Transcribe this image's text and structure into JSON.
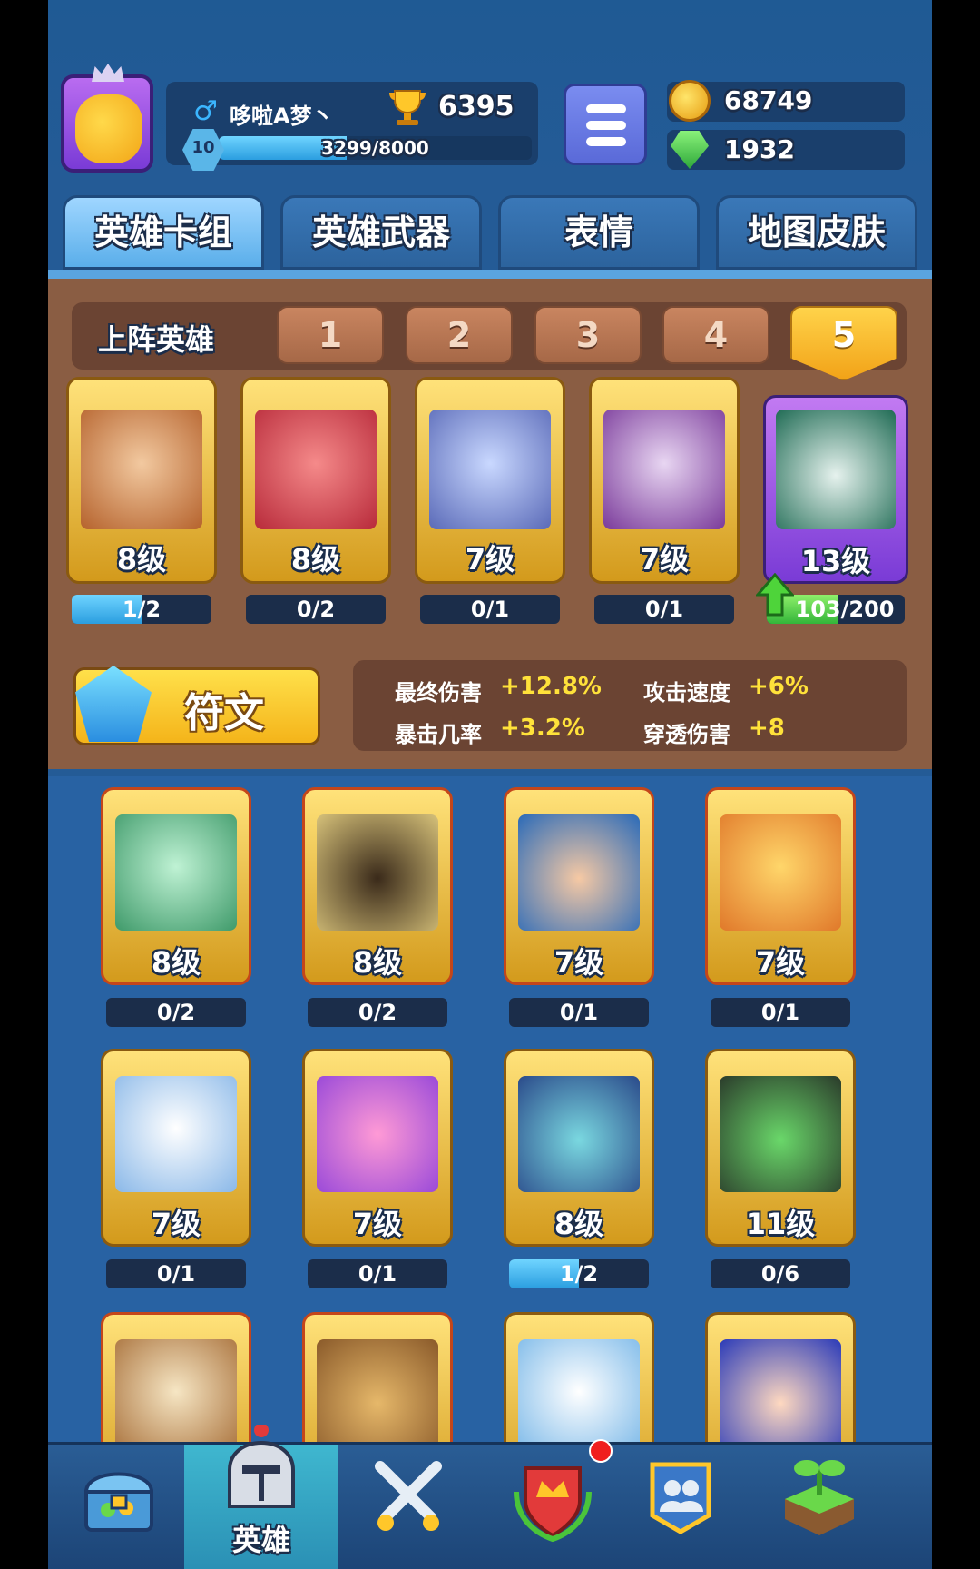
{
  "player": {
    "gender_symbol": "♂",
    "name": "哆啦A梦丶",
    "trophies": "6395",
    "level": "10",
    "xp_text": "3299/8000",
    "xp_progress": 0.41
  },
  "resources": {
    "coins": "68749",
    "gems": "1932"
  },
  "tabs": [
    "英雄卡组",
    "英雄武器",
    "表情",
    "地图皮肤"
  ],
  "deck": {
    "label": "上阵英雄",
    "slots": [
      "1",
      "2",
      "3",
      "4",
      "5"
    ],
    "selected_slot": "5",
    "heroes": [
      {
        "level": "8级",
        "progress": "1/2",
        "fill": 0.5
      },
      {
        "level": "8级",
        "progress": "0/2",
        "fill": 0
      },
      {
        "level": "7级",
        "progress": "0/1",
        "fill": 0
      },
      {
        "level": "7级",
        "progress": "0/1",
        "fill": 0
      },
      {
        "level": "13级",
        "progress": "103/200",
        "fill": 0.52
      }
    ]
  },
  "rune": {
    "label": "符文",
    "stats": [
      {
        "name": "最终伤害",
        "value": "+12.8%"
      },
      {
        "name": "攻击速度",
        "value": "+6%"
      },
      {
        "name": "暴击几率",
        "value": "+3.2%"
      },
      {
        "name": "穿透伤害",
        "value": "+8"
      }
    ]
  },
  "collection": [
    {
      "level": "8级",
      "progress": "0/2",
      "fill": 0
    },
    {
      "level": "8级",
      "progress": "0/2",
      "fill": 0
    },
    {
      "level": "7级",
      "progress": "0/1",
      "fill": 0
    },
    {
      "level": "7级",
      "progress": "0/1",
      "fill": 0
    },
    {
      "level": "7级",
      "progress": "0/1",
      "fill": 0
    },
    {
      "level": "7级",
      "progress": "0/1",
      "fill": 0
    },
    {
      "level": "8级",
      "progress": "1/2",
      "fill": 0.5
    },
    {
      "level": "11级",
      "progress": "0/6",
      "fill": 0
    }
  ],
  "nav": {
    "heroes_label": "英雄",
    "active": "heroes"
  }
}
